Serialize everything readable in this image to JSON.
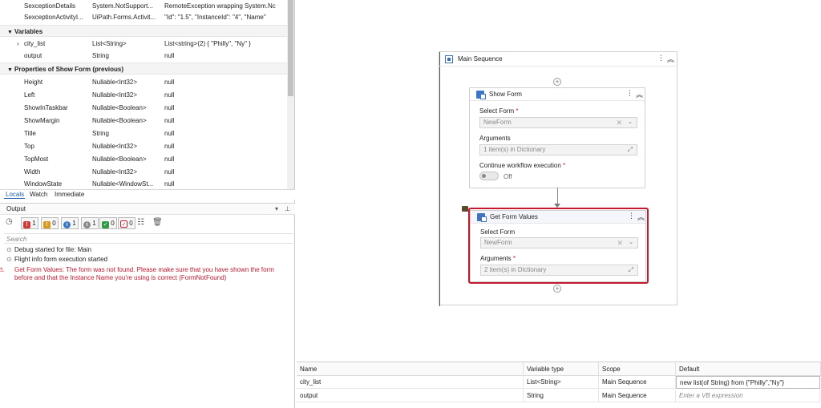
{
  "locals": {
    "rows_top": [
      {
        "name": "SexceptionDetails",
        "type": "System.NotSupport...",
        "value": "RemoteException wrapping System.Nc"
      },
      {
        "name": "SexceptionActivityI...",
        "type": "UiPath.Forms.Activit...",
        "value": "\"Id\": \"1.5\",  \"InstanceId\": \"4\",  \"Name\""
      }
    ],
    "section_variables": "Variables",
    "variables": [
      {
        "name": "city_list",
        "type": "List<String>",
        "value": "List<string>(2) { \"Philly\", \"Ny\" }",
        "expander": "›"
      },
      {
        "name": "output",
        "type": "String",
        "value": "null"
      }
    ],
    "section_properties": "Properties of Show Form (previous)",
    "properties": [
      {
        "name": "Height",
        "type": "Nullable<Int32>",
        "value": "null"
      },
      {
        "name": "Left",
        "type": "Nullable<Int32>",
        "value": "null"
      },
      {
        "name": "ShowInTaskbar",
        "type": "Nullable<Boolean>",
        "value": "null"
      },
      {
        "name": "ShowMargin",
        "type": "Nullable<Boolean>",
        "value": "null"
      },
      {
        "name": "Title",
        "type": "String",
        "value": "null"
      },
      {
        "name": "Top",
        "type": "Nullable<Int32>",
        "value": "null"
      },
      {
        "name": "TopMost",
        "type": "Nullable<Boolean>",
        "value": "null"
      },
      {
        "name": "Width",
        "type": "Nullable<Int32>",
        "value": "null"
      },
      {
        "name": "WindowState",
        "type": "Nullable<WindowSt...",
        "value": "null"
      }
    ]
  },
  "tabs": {
    "locals": "Locals",
    "watch": "Watch",
    "immediate": "Immediate"
  },
  "output": {
    "title": "Output",
    "dropdown": "▾",
    "pin": "⊥",
    "filters": {
      "error_count": "1",
      "warning_count": "0",
      "info_count": "1",
      "trace_count": "1",
      "success_count": "0",
      "fail_count": "0"
    },
    "search_placeholder": "Search",
    "lines": [
      {
        "mark": "⊙",
        "text": "Debug started for file: Main"
      },
      {
        "mark": "⊙",
        "text": "Flight info form execution started"
      },
      {
        "mark": "⚠",
        "text": "Get Form Values: The form was not found. Please make sure that you have shown the form before and that the Instance Name you're using is correct (FormNotFound)"
      }
    ]
  },
  "designer": {
    "main_sequence": "Main Sequence",
    "show_form": {
      "title": "Show Form",
      "select_form_label": "Select Form",
      "select_form_value": "NewForm",
      "arguments_label": "Arguments",
      "arguments_value": "1 item(s) in Dictionary",
      "continue_label": "Continue workflow execution",
      "toggle_label": "Off"
    },
    "get_form_values": {
      "title": "Get Form Values",
      "select_form_label": "Select Form",
      "select_form_value": "NewForm",
      "arguments_label": "Arguments",
      "arguments_value": "2 item(s) in Dictionary"
    },
    "required_mark": "*",
    "menu_glyph": "⋮",
    "collapse_glyph": "︽",
    "plus_glyph": "+",
    "clear_glyph": "✕",
    "dropdown_glyph": "⌄",
    "expand_glyph": "⤢"
  },
  "variables_panel": {
    "headers": {
      "name": "Name",
      "type": "Variable type",
      "scope": "Scope",
      "default": "Default"
    },
    "rows": [
      {
        "name": "city_list",
        "type": "List<String>",
        "scope": "Main Sequence",
        "default": "new list(of String) from {\"Philly\",\"Ny\"}"
      },
      {
        "name": "output",
        "type": "String",
        "scope": "Main Sequence",
        "default": "Enter a VB expression"
      }
    ]
  },
  "colors": {
    "accent": "#1b5fa8",
    "error": "#c4182e",
    "activity_icon": "#3f74c4"
  }
}
